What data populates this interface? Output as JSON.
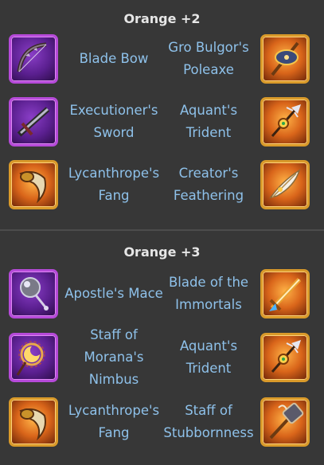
{
  "sections": [
    {
      "title": "Orange +2",
      "rows": [
        {
          "left": {
            "name": "Blade Bow",
            "frame": "purple",
            "icon": "bow-icon"
          },
          "right": {
            "name": "Gro Bulgor's Poleaxe",
            "frame": "orange",
            "icon": "poleaxe-icon"
          }
        },
        {
          "left": {
            "name": "Executioner's Sword",
            "frame": "purple",
            "icon": "sword-icon"
          },
          "right": {
            "name": "Aquant's Trident",
            "frame": "orange",
            "icon": "trident-icon"
          }
        },
        {
          "left": {
            "name": "Lycanthrope's Fang",
            "frame": "orange",
            "icon": "fang-icon"
          },
          "right": {
            "name": "Creator's Feathering",
            "frame": "orange",
            "icon": "feather-icon"
          }
        }
      ]
    },
    {
      "title": "Orange +3",
      "rows": [
        {
          "left": {
            "name": "Apostle's Mace",
            "frame": "purple",
            "icon": "mace-icon"
          },
          "right": {
            "name": "Blade of the Immortals",
            "frame": "orange",
            "icon": "blade-icon"
          }
        },
        {
          "left": {
            "name": "Staff of Morana's Nimbus",
            "frame": "purple",
            "icon": "staff-icon"
          },
          "right": {
            "name": "Aquant's Trident",
            "frame": "orange",
            "icon": "trident-icon"
          }
        },
        {
          "left": {
            "name": "Lycanthrope's Fang",
            "frame": "orange",
            "icon": "fang-icon"
          },
          "right": {
            "name": "Staff of Stubbornness",
            "frame": "orange",
            "icon": "hammer-staff-icon"
          }
        }
      ]
    }
  ]
}
